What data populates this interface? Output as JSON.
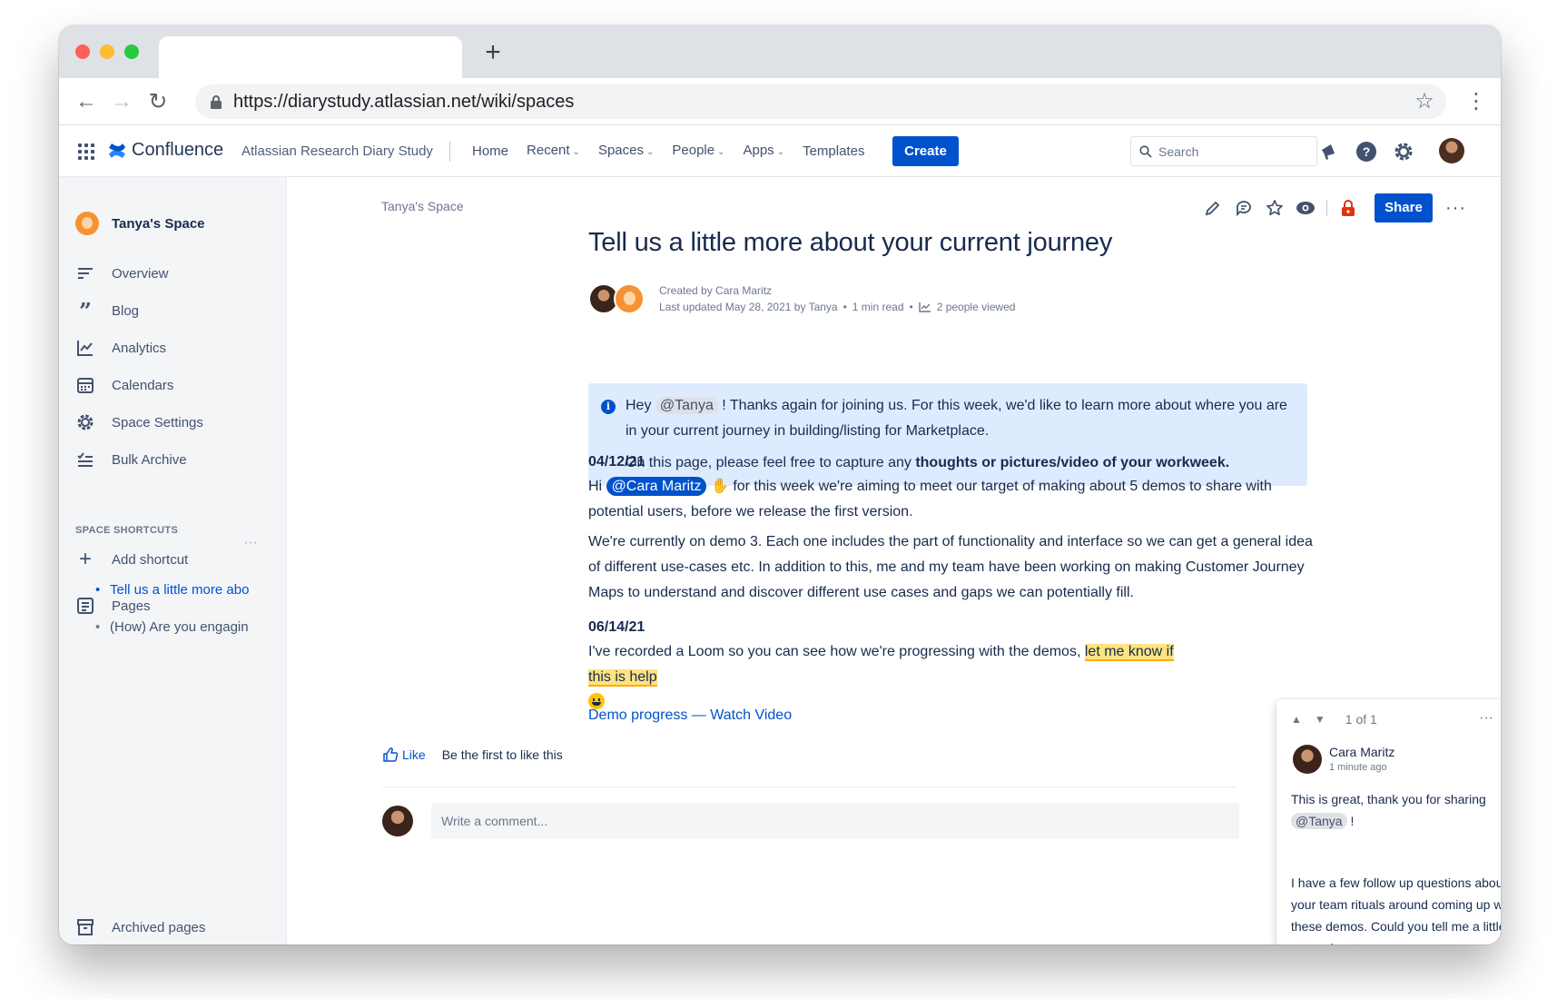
{
  "browser": {
    "url": "https://diarystudy.atlassian.net/wiki/spaces",
    "new_tab": "+",
    "back": "←",
    "forward": "→",
    "reload": "↻",
    "star": "☆",
    "menu": "⋮"
  },
  "topnav": {
    "logo_text": "Confluence",
    "space_title": "Atlassian Research Diary Study",
    "items": [
      "Home",
      "Recent",
      "Spaces",
      "People",
      "Apps",
      "Templates"
    ],
    "create_label": "Create",
    "search_placeholder": "Search"
  },
  "sidebar": {
    "space_name": "Tanya's Space",
    "items": [
      {
        "label": "Overview",
        "icon": "overview-icon"
      },
      {
        "label": "Blog",
        "icon": "blog-quote-icon"
      },
      {
        "label": "Analytics",
        "icon": "analytics-icon"
      },
      {
        "label": "Calendars",
        "icon": "calendar-icon"
      },
      {
        "label": "Space Settings",
        "icon": "gear-icon"
      },
      {
        "label": "Bulk Archive",
        "icon": "bulk-archive-icon"
      }
    ],
    "shortcuts_heading": "SPACE SHORTCUTS",
    "add_shortcut": "Add shortcut",
    "pages_label": "Pages",
    "pages_more": "···",
    "pages": [
      "Tell us a little more abo",
      "(How) Are you engagin"
    ],
    "archived": "Archived pages"
  },
  "page": {
    "breadcrumb": "Tanya's Space",
    "share_label": "Share",
    "more": "···",
    "title": "Tell us a little more about your current journey",
    "created_by": "Created by Cara Maritz",
    "last_updated": "Last updated May 28, 2021 by Tanya",
    "read_time": "1 min read",
    "viewed": "2 people viewed",
    "info": {
      "hey": "Hey",
      "mention": "@Tanya",
      "line1_rest": "! Thanks again for joining us. For this week, we'd like to learn more about where you are in your current journey in building/listing for Marketplace.",
      "line2_pre": "On this page, please feel free to capture any",
      "line2_bold": "thoughts or pictures/video of your workweek."
    },
    "date1": "04/12/21",
    "p1_hi": "Hi",
    "p1_mention": "@Cara Maritz",
    "p1_rest": "for this week we're aiming to meet our target of making about 5 demos to share with potential users, before we release the first version.",
    "p2": "We're currently on demo 3. Each one includes the part of functionality and interface so we can get a general idea of different use-cases etc. In addition to this, me and my team have been working on making Customer Journey Maps to understand and discover different use cases and gaps we can potentially fill.",
    "date2": "06/14/21",
    "p3_pre": "I've recorded a Loom so you can see how we're progressing with the demos,",
    "p3_highlight": "let me know if this is help",
    "video_link": "Demo progress — Watch Video",
    "like_label": "Like",
    "like_text": "Be the first to like this",
    "comment_placeholder": "Write a comment..."
  },
  "comment_panel": {
    "count": "1 of 1",
    "dots": "···",
    "close": "✕",
    "author": "Cara Maritz",
    "time": "1 minute ago",
    "body1_pre": "This is great, thank you for sharing",
    "body1_mention": "@Tanya",
    "body1_post": "!",
    "body2": "I have a few follow up questions about your team rituals around coming up with these demos. Could you tell me a little bit more about -"
  }
}
